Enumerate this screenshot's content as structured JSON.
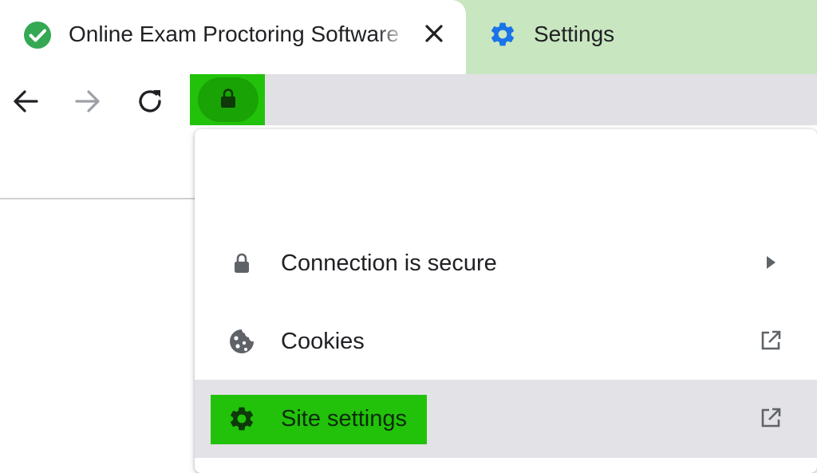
{
  "tabs": [
    {
      "title": "Online Exam Proctoring Software",
      "icon": "check-circle-icon",
      "active": true
    },
    {
      "title": "Settings",
      "icon": "gear-icon",
      "active": false
    }
  ],
  "toolbar": {
    "back": "back-arrow-icon",
    "forward": "forward-arrow-icon",
    "reload": "reload-icon",
    "site_info": "lock-icon"
  },
  "site_info_popup": {
    "items": [
      {
        "label": "Connection is secure",
        "icon": "lock-icon",
        "trailing": "chevron-right-icon"
      },
      {
        "label": "Cookies",
        "icon": "cookie-icon",
        "trailing": "open-external-icon"
      },
      {
        "label": "Site settings",
        "icon": "gear-icon",
        "trailing": "open-external-icon"
      }
    ]
  },
  "colors": {
    "highlight": "#22c20a",
    "tab_strip": "#c8e6c0",
    "omnibox": "#e1e0e5",
    "favicon_green": "#34a853",
    "settings_blue": "#1a73e8"
  }
}
